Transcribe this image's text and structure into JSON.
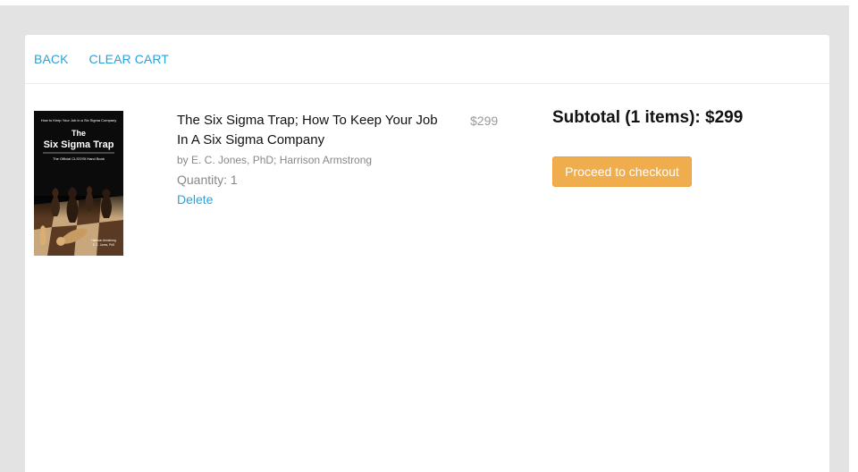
{
  "nav": {
    "back_label": "BACK",
    "clear_cart_label": "CLEAR CART"
  },
  "cart": {
    "items": [
      {
        "title": "The Six Sigma Trap; How To Keep Your Job In A Six Sigma Company",
        "authors": "by E. C. Jones, PhD; Harrison Armstrong",
        "quantity_text": "Quantity: 1",
        "delete_label": "Delete",
        "price": "$299",
        "cover": {
          "tagline": "How to Keep Your Job in a Six Sigma Company",
          "title_line1": "The",
          "title_line2": "Six Sigma Trap",
          "subtitle": "The Official CLSSYB Hand Book",
          "authors_line1": "Harrison Armstrong",
          "authors_line2": "E. C. Jones, PhD"
        }
      }
    ],
    "subtotal_text": "Subtotal (1 items): $299",
    "checkout_label": "Proceed to checkout"
  },
  "colors": {
    "link": "#2aa3db",
    "checkout_button": "#f0ad4e",
    "backdrop": "#e3e3e3"
  }
}
